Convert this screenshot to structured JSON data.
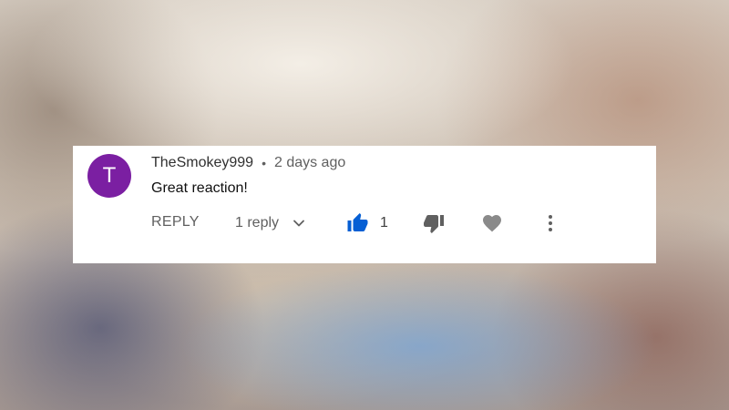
{
  "comment": {
    "avatar_letter": "T",
    "avatar_color": "#7b1fa2",
    "author": "TheSmokey999",
    "separator": "•",
    "timestamp": "2 days ago",
    "text": "Great reaction!"
  },
  "actions": {
    "reply_label": "REPLY",
    "replies_label": "1 reply",
    "replies_toggle_icon": "chevron-down-icon",
    "like_icon": "thumbs-up-icon",
    "like_state": "active",
    "like_color": "#065fd4",
    "like_count": "1",
    "dislike_icon": "thumbs-down-icon",
    "heart_icon": "heart-icon",
    "more_icon": "more-vertical-icon",
    "icon_color": "#606060"
  }
}
